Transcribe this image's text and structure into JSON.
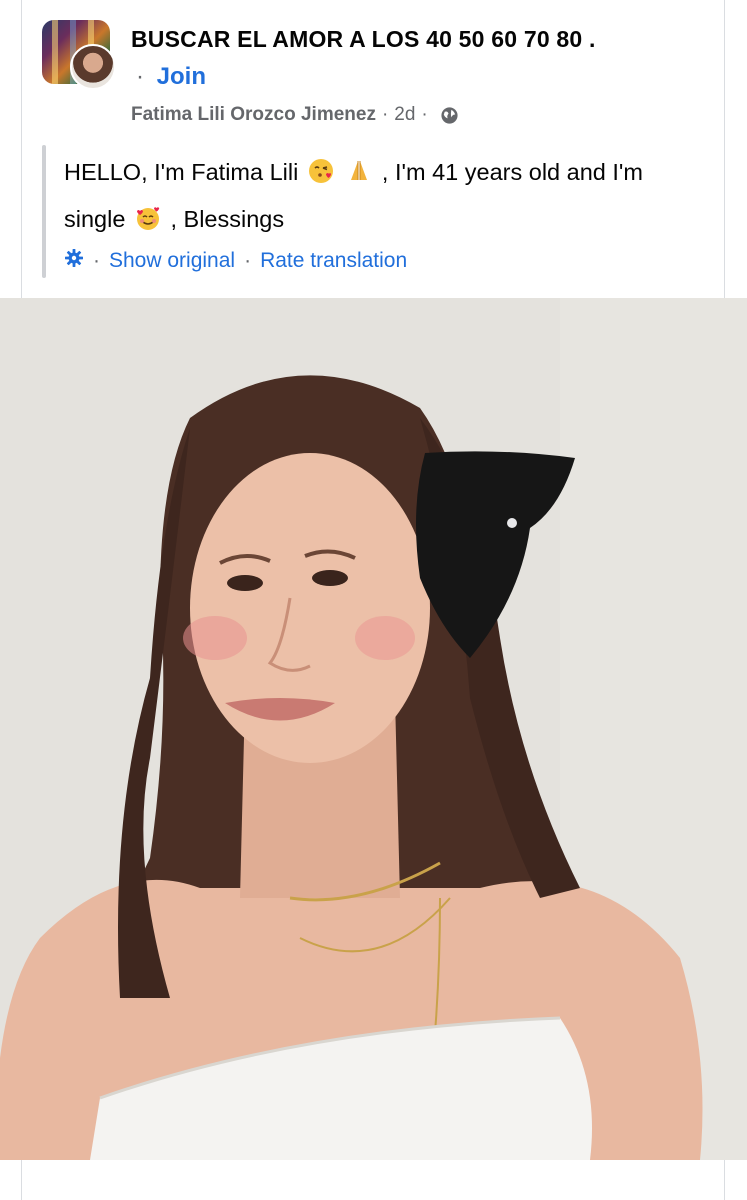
{
  "post": {
    "group_name": "BUSCAR EL AMOR A LOS 40 50 60 70 80 .",
    "join_separator": "·",
    "join_label": "Join",
    "author": "Fatima Lili Orozco Jimenez",
    "timestamp": "2d",
    "meta_separator": "·",
    "privacy_icon": "globe-icon",
    "text_part1": "HELLO, I'm Fatima Lili",
    "text_part2": ", I'm 41 years old and I'm single",
    "text_part3": ", Blessings",
    "emojis": [
      "face-blowing-kiss",
      "folded-hands",
      "smiling-face-with-hearts"
    ],
    "translation": {
      "settings_icon": "gear-icon",
      "separator": "·",
      "show_original": "Show original",
      "rate_translation": "Rate translation"
    }
  },
  "colors": {
    "link_blue": "#216fdb",
    "secondary_text": "#65676b",
    "primary_text": "#050505",
    "divider": "#ced0d4"
  }
}
